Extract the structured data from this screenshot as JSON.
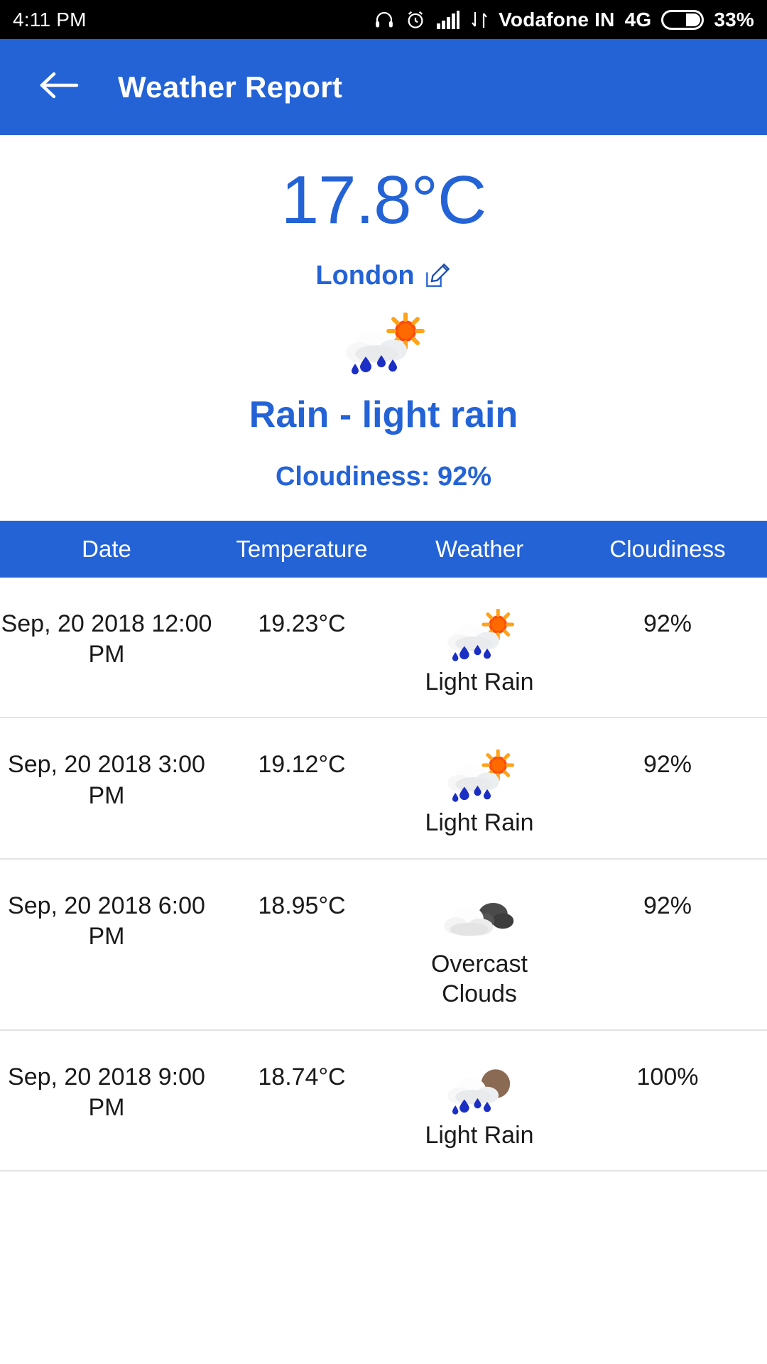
{
  "status_bar": {
    "time": "4:11 PM",
    "carrier": "Vodafone IN",
    "network": "4G",
    "battery_percent": "33%",
    "icons": [
      "headphones-icon",
      "alarm-clock-icon",
      "signal-bars-icon",
      "data-transfer-icon",
      "battery-icon"
    ]
  },
  "app_bar": {
    "back_icon": "back-arrow-icon",
    "title": "Weather Report",
    "background": "#2463d6"
  },
  "current": {
    "temperature": "17.8°C",
    "city": "London",
    "edit_icon": "edit-location-icon",
    "condition_icon": "sun-behind-rain-cloud-icon",
    "condition": "Rain - light rain",
    "cloudiness": "Cloudiness: 92%",
    "accent_color": "#2463d6"
  },
  "forecast_table": {
    "columns": [
      "Date",
      "Temperature",
      "Weather",
      "Cloudiness"
    ],
    "rows": [
      {
        "date": "Sep, 20 2018 12:00 PM",
        "temperature": "19.23°C",
        "weather_icon": "sun-behind-rain-cloud-icon",
        "weather": "Light Rain",
        "cloudiness": "92%"
      },
      {
        "date": "Sep, 20 2018 3:00 PM",
        "temperature": "19.12°C",
        "weather_icon": "sun-behind-rain-cloud-icon",
        "weather": "Light Rain",
        "cloudiness": "92%"
      },
      {
        "date": "Sep, 20 2018 6:00 PM",
        "temperature": "18.95°C",
        "weather_icon": "overcast-clouds-icon",
        "weather": "Overcast Clouds",
        "cloudiness": "92%"
      },
      {
        "date": "Sep, 20 2018 9:00 PM",
        "temperature": "18.74°C",
        "weather_icon": "moon-behind-rain-cloud-icon",
        "weather": "Light Rain",
        "cloudiness": "100%"
      }
    ]
  }
}
